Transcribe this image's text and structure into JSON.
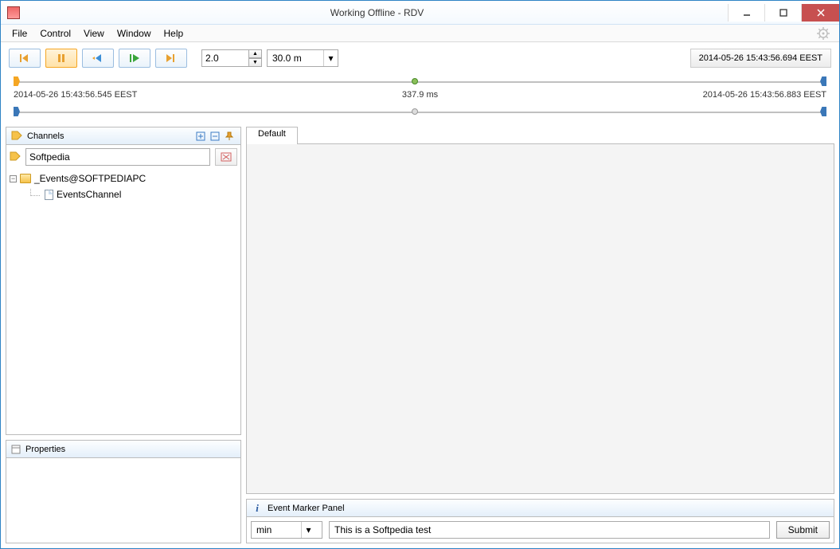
{
  "title": "Working Offline - RDV",
  "menu": {
    "file": "File",
    "control": "Control",
    "view": "View",
    "window": "Window",
    "help": "Help"
  },
  "toolbar": {
    "speed": "2.0",
    "range": "30.0 m",
    "current_time": "2014-05-26 15:43:56.694 EEST"
  },
  "timeline": {
    "start": "2014-05-26 15:43:56.545 EEST",
    "duration": "337.9 ms",
    "end": "2014-05-26 15:43:56.883 EEST"
  },
  "channels": {
    "title": "Channels",
    "search": "Softpedia",
    "tree": {
      "root": "_Events@SOFTPEDIAPC",
      "child": "EventsChannel"
    }
  },
  "properties": {
    "title": "Properties"
  },
  "tab": {
    "default": "Default"
  },
  "event_panel": {
    "title": "Event Marker Panel",
    "unit": "min",
    "text": "This is a Softpedia test",
    "submit": "Submit"
  }
}
